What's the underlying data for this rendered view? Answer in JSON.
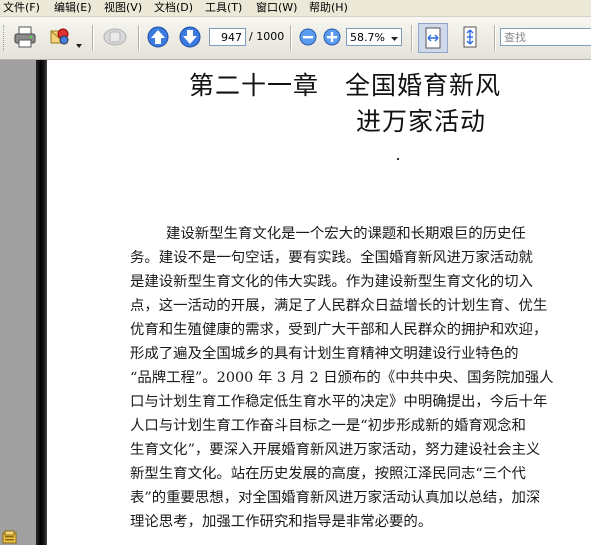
{
  "menu": {
    "items": [
      "文件(F)",
      "编辑(E)",
      "视图(V)",
      "文档(D)",
      "工具(T)",
      "窗口(W)",
      "帮助(H)"
    ]
  },
  "toolbar": {
    "page_current": "947",
    "page_total": "/ 1000",
    "zoom": "58.7%",
    "search_placeholder": "查找",
    "icons": [
      "printer-icon",
      "email-icon",
      "hand-disabled-icon",
      "prev-page-icon",
      "next-page-icon",
      "zoom-out-icon",
      "zoom-in-icon",
      "fit-width-icon",
      "fit-page-icon"
    ]
  },
  "document": {
    "title_line1": "第二十一章　全国婚育新风",
    "title_line2": "进万家活动",
    "body_lines": [
      "建设新型生育文化是一个宏大的课题和长期艰巨的历史任",
      "务。建设不是一句空话，要有实践。全国婚育新风进万家活动就",
      "是建设新型生育文化的伟大实践。作为建设新型生育文化的切入",
      "点，这一活动的开展，满足了人民群众日益增长的计划生育、优生",
      "优育和生殖健康的需求，受到广大干部和人民群众的拥护和欢迎，",
      "形成了遍及全国城乡的具有计划生育精神文明建设行业特色的",
      "“品牌工程”。2000 年 3 月 2 日颁布的《中共中央、国务院加强人",
      "口与计划生育工作稳定低生育水平的决定》中明确提出，今后十年",
      "人口与计划生育工作奋斗目标之一是“初步形成新的婚育观念和",
      "生育文化”，要深入开展婚育新风进万家活动，努力建设社会主义",
      "新型生育文化。站在历史发展的高度，按照江泽民同志“三个代",
      "表”的重要思想，对全国婚育新风进万家活动认真加以总结，加深",
      "理论思考，加强工作研究和指导是非常必要的。"
    ]
  },
  "colors": {
    "menubar_bg": "#ece9d8",
    "arrow_blue": "#2f6fd6",
    "page_bg": "#ffffff"
  }
}
